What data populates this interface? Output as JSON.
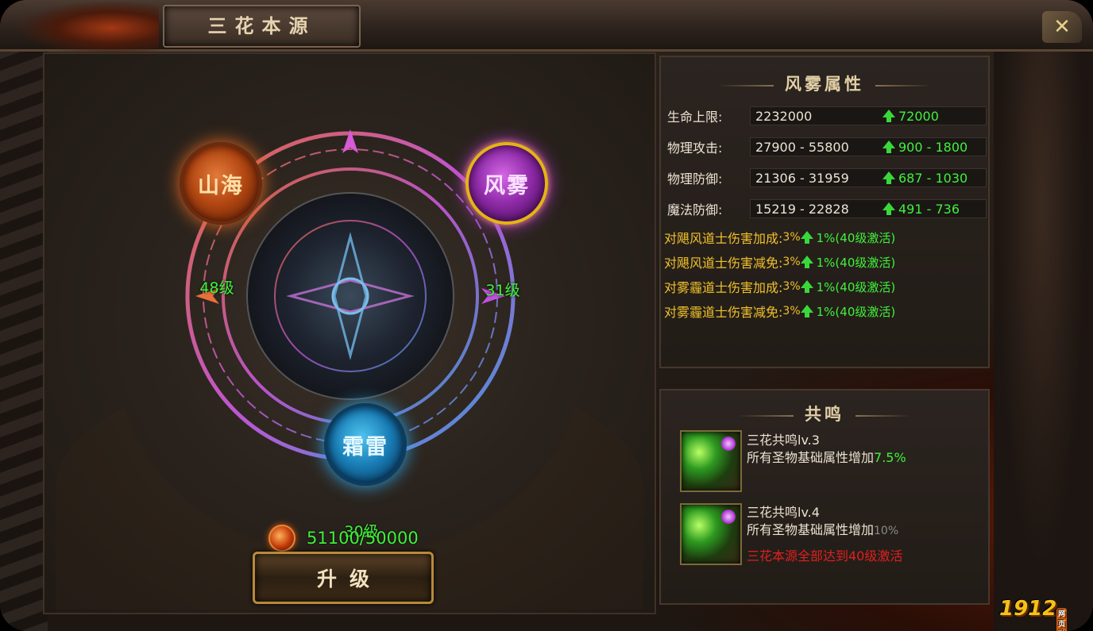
{
  "window": {
    "title": "三花本源",
    "close_icon": "close-x-icon"
  },
  "nodes": {
    "shanhai": {
      "name": "山海",
      "level": "48级",
      "color": "#e06a28"
    },
    "fengwu": {
      "name": "风雾",
      "level": "31级",
      "color": "#c23ee0"
    },
    "shuanglei": {
      "name": "霜雷",
      "level": "30级",
      "color": "#2fa8e8"
    }
  },
  "upgrade": {
    "cost": "51100/50000",
    "button_label": "升级",
    "currency_icon": "soul-gem-icon"
  },
  "attributes": {
    "title": "风雾属性",
    "stats": [
      {
        "label": "生命上限:",
        "current": "2232000",
        "increase": "72000"
      },
      {
        "label": "物理攻击:",
        "current": "27900 - 55800",
        "increase": "900 - 1800"
      },
      {
        "label": "物理防御:",
        "current": "21306 - 31959",
        "increase": "687 - 1030"
      },
      {
        "label": "魔法防御:",
        "current": "15219 - 22828",
        "increase": "491 - 736"
      }
    ],
    "bonuses": [
      {
        "label": "对飓风道士伤害加成:",
        "value": "3%",
        "increase": "1%(40级激活)"
      },
      {
        "label": "对飓风道士伤害减免:",
        "value": "3%",
        "increase": "1%(40级激活)"
      },
      {
        "label": "对雾霾道士伤害加成:",
        "value": "3%",
        "increase": "1%(40级激活)"
      },
      {
        "label": "对雾霾道士伤害减免:",
        "value": "3%",
        "increase": "1%(40级激活)"
      }
    ]
  },
  "resonance": {
    "title": "共鸣",
    "items": [
      {
        "name": "三花共鸣lv.3",
        "desc": "所有圣物基础属性增加",
        "pct": "7.5%",
        "active": true,
        "condition": ""
      },
      {
        "name": "三花共鸣lv.4",
        "desc": "所有圣物基础属性增加",
        "pct": "10%",
        "active": false,
        "condition": "三花本源全部达到40级激活"
      }
    ]
  },
  "watermark": {
    "text": "1912",
    "tag": "网页游戏"
  }
}
